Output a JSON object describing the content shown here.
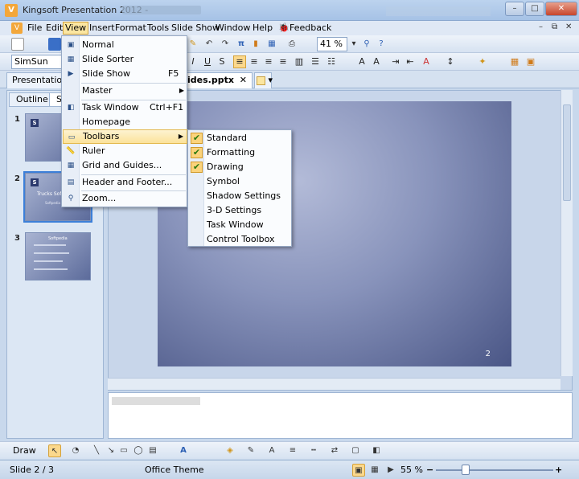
{
  "window": {
    "title": "Kingsoft Presentation 2012 -",
    "min": "–",
    "max": "□",
    "close": "✕"
  },
  "menubar": {
    "items": [
      "File",
      "Edit",
      "View",
      "Insert",
      "Format",
      "Tools",
      "Slide Show",
      "Window",
      "Help",
      "Feedback"
    ],
    "active": "View"
  },
  "toolbar": {
    "font": "SimSun",
    "zoom": "41 %"
  },
  "tabs": {
    "main": "Presentation",
    "file": "ides.pptx",
    "close": "✕"
  },
  "left_panel": {
    "tabs": [
      "Outline",
      "Sl"
    ],
    "slides": [
      {
        "number": "1"
      },
      {
        "number": "2",
        "title": "Trucks Softwa",
        "subtitle": "Softpedia Test",
        "selected": true
      },
      {
        "number": "3",
        "title": "Softpedia"
      }
    ]
  },
  "slide": {
    "page_number": "2"
  },
  "view_menu": {
    "items": [
      {
        "label": "Normal",
        "shortcut": "",
        "submenu": false,
        "icon": "normal-view-icon"
      },
      {
        "label": "Slide Sorter",
        "shortcut": "",
        "submenu": false,
        "icon": "slide-sorter-icon"
      },
      {
        "label": "Slide Show",
        "shortcut": "F5",
        "submenu": false,
        "icon": "slide-show-icon"
      },
      {
        "label": "Master",
        "shortcut": "",
        "submenu": true,
        "icon": ""
      },
      {
        "label": "Task Window",
        "shortcut": "Ctrl+F1",
        "submenu": false,
        "icon": "task-window-icon"
      },
      {
        "label": "Homepage",
        "shortcut": "",
        "submenu": false,
        "icon": ""
      },
      {
        "label": "Toolbars",
        "shortcut": "",
        "submenu": true,
        "icon": "toolbars-icon",
        "highlighted": true
      },
      {
        "label": "Ruler",
        "shortcut": "",
        "submenu": false,
        "icon": "ruler-icon"
      },
      {
        "label": "Grid and Guides...",
        "shortcut": "",
        "submenu": false,
        "icon": "grid-icon"
      },
      {
        "label": "Header and Footer...",
        "shortcut": "",
        "submenu": false,
        "icon": "header-footer-icon"
      },
      {
        "label": "Zoom...",
        "shortcut": "",
        "submenu": false,
        "icon": "zoom-icon"
      }
    ]
  },
  "toolbars_submenu": {
    "items": [
      {
        "label": "Standard",
        "checked": true
      },
      {
        "label": "Formatting",
        "checked": true
      },
      {
        "label": "Drawing",
        "checked": true
      },
      {
        "label": "Symbol",
        "checked": false
      },
      {
        "label": "Shadow Settings",
        "checked": false
      },
      {
        "label": "3-D Settings",
        "checked": false
      },
      {
        "label": "Task Window",
        "checked": false
      },
      {
        "label": "Control Toolbox",
        "checked": false
      }
    ]
  },
  "drawbar": {
    "label": "Draw"
  },
  "statusbar": {
    "slide": "Slide 2 / 3",
    "theme": "Office Theme",
    "zoom": "55 %",
    "zoom_out": "−",
    "zoom_in": "+"
  },
  "glyphs": {
    "submenu_arrow": "▶",
    "check": "✔",
    "dropdown_arrow": "▾"
  }
}
